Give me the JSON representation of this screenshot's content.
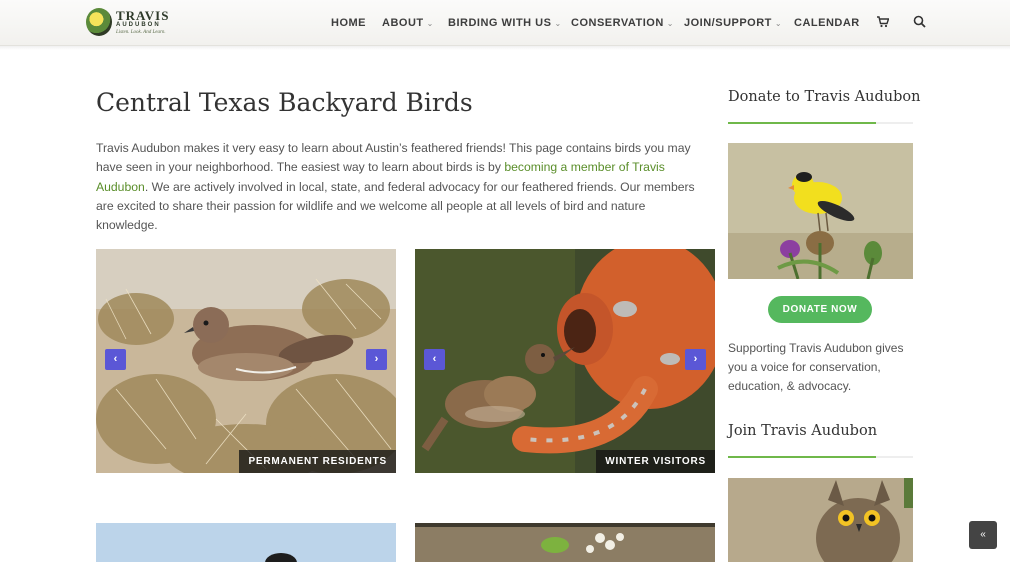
{
  "site": {
    "logo_title": "TRAVIS",
    "logo_subtitle": "AUDUBON",
    "logo_tagline": "Listen. Look. And Learn."
  },
  "nav": {
    "items": [
      {
        "label": "HOME",
        "has_caret": false
      },
      {
        "label": "ABOUT",
        "has_caret": true
      },
      {
        "label": "BIRDING WITH US",
        "has_caret": true
      },
      {
        "label": "CONSERVATION",
        "has_caret": true
      },
      {
        "label": "JOIN/SUPPORT",
        "has_caret": true
      },
      {
        "label": "CALENDAR",
        "has_caret": false
      }
    ],
    "cart_icon": "cart-icon",
    "search_icon": "search-icon"
  },
  "main": {
    "title": "Central Texas Backyard Birds",
    "intro_before_link": "Travis Audubon makes it very easy to learn about Austin’s feathered friends! This page contains birds you may have seen in your neighborhood. The easiest way to learn about birds is by ",
    "intro_link": "becoming a member of Travis Audubon",
    "intro_after_link": ". We are actively involved in local, state, and federal advocacy for our feathered friends. Our members are excited to share their passion for wildlife and we welcome all people at all levels of bird and nature knowledge.",
    "cards": [
      {
        "label": "PERMANENT RESIDENTS",
        "prev": "‹",
        "next": "›"
      },
      {
        "label": "WINTER VISITORS",
        "prev": "‹",
        "next": "›"
      }
    ]
  },
  "sidebar": {
    "donate_heading": "Donate to Travis Audubon",
    "donate_button": "DONATE NOW",
    "donate_text": "Supporting Travis Audubon gives you a voice for conservation, education, & advocacy.",
    "join_heading": "Join Travis Audubon"
  },
  "back_to_top": "«",
  "colors": {
    "accent_green": "#5a8e2a",
    "button_green": "#55b85e",
    "slider_arrow": "#5b57d6"
  }
}
